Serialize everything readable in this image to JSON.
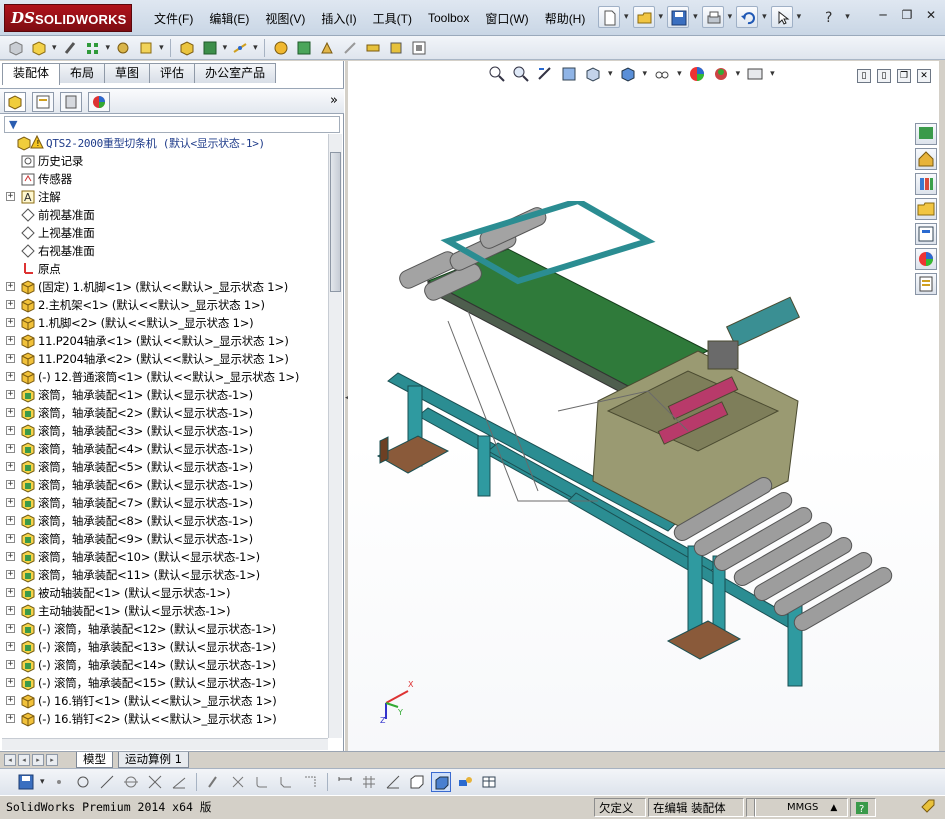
{
  "app": {
    "logo_prefix": "DS",
    "logo_name": "SOLIDWORKS"
  },
  "menu": [
    "文件(F)",
    "编辑(E)",
    "视图(V)",
    "插入(I)",
    "工具(T)",
    "Toolbox",
    "窗口(W)",
    "帮助(H)"
  ],
  "tabs": [
    "装配体",
    "布局",
    "草图",
    "评估",
    "办公室产品"
  ],
  "tree": {
    "root": "QTS2-2000重型切条机  (默认<显示状态-1>)",
    "items": [
      {
        "label": "历史记录",
        "icon": "history-icon",
        "exp": false
      },
      {
        "label": "传感器",
        "icon": "sensor-icon",
        "exp": false
      },
      {
        "label": "注解",
        "icon": "annotation-icon",
        "exp": true
      },
      {
        "label": "前视基准面",
        "icon": "plane-icon",
        "exp": false
      },
      {
        "label": "上视基准面",
        "icon": "plane-icon",
        "exp": false
      },
      {
        "label": "右视基准面",
        "icon": "plane-icon",
        "exp": false
      },
      {
        "label": "原点",
        "icon": "origin-icon",
        "exp": false
      },
      {
        "label": "(固定) 1.机脚<1> (默认<<默认>_显示状态 1>)",
        "icon": "part-icon",
        "exp": true
      },
      {
        "label": "2.主机架<1> (默认<<默认>_显示状态 1>)",
        "icon": "part-icon",
        "exp": true
      },
      {
        "label": "1.机脚<2> (默认<<默认>_显示状态 1>)",
        "icon": "part-icon",
        "exp": true
      },
      {
        "label": "11.P204轴承<1> (默认<<默认>_显示状态 1>)",
        "icon": "part-icon",
        "exp": true
      },
      {
        "label": "11.P204轴承<2> (默认<<默认>_显示状态 1>)",
        "icon": "part-icon",
        "exp": true
      },
      {
        "label": "(-) 12.普通滚筒<1> (默认<<默认>_显示状态 1>)",
        "icon": "part-icon",
        "exp": true
      },
      {
        "label": "滚筒，轴承装配<1> (默认<显示状态-1>)",
        "icon": "assembly-icon",
        "exp": true
      },
      {
        "label": "滚筒，轴承装配<2> (默认<显示状态-1>)",
        "icon": "assembly-icon",
        "exp": true
      },
      {
        "label": "滚筒，轴承装配<3> (默认<显示状态-1>)",
        "icon": "assembly-icon",
        "exp": true
      },
      {
        "label": "滚筒，轴承装配<4> (默认<显示状态-1>)",
        "icon": "assembly-icon",
        "exp": true
      },
      {
        "label": "滚筒，轴承装配<5> (默认<显示状态-1>)",
        "icon": "assembly-icon",
        "exp": true
      },
      {
        "label": "滚筒，轴承装配<6> (默认<显示状态-1>)",
        "icon": "assembly-icon",
        "exp": true
      },
      {
        "label": "滚筒，轴承装配<7> (默认<显示状态-1>)",
        "icon": "assembly-icon",
        "exp": true
      },
      {
        "label": "滚筒，轴承装配<8> (默认<显示状态-1>)",
        "icon": "assembly-icon",
        "exp": true
      },
      {
        "label": "滚筒，轴承装配<9> (默认<显示状态-1>)",
        "icon": "assembly-icon",
        "exp": true
      },
      {
        "label": "滚筒，轴承装配<10> (默认<显示状态-1>)",
        "icon": "assembly-icon",
        "exp": true
      },
      {
        "label": "滚筒，轴承装配<11> (默认<显示状态-1>)",
        "icon": "assembly-icon",
        "exp": true
      },
      {
        "label": "被动轴装配<1> (默认<显示状态-1>)",
        "icon": "assembly-icon",
        "exp": true
      },
      {
        "label": "主动轴装配<1> (默认<显示状态-1>)",
        "icon": "assembly-icon",
        "exp": true
      },
      {
        "label": "(-) 滚筒，轴承装配<12> (默认<显示状态-1>)",
        "icon": "assembly-icon",
        "exp": true
      },
      {
        "label": "(-) 滚筒，轴承装配<13> (默认<显示状态-1>)",
        "icon": "assembly-icon",
        "exp": true
      },
      {
        "label": "(-) 滚筒，轴承装配<14> (默认<显示状态-1>)",
        "icon": "assembly-icon",
        "exp": true
      },
      {
        "label": "(-) 滚筒，轴承装配<15> (默认<显示状态-1>)",
        "icon": "assembly-icon",
        "exp": true
      },
      {
        "label": "(-) 16.销钉<1> (默认<<默认>_显示状态 1>)",
        "icon": "part-icon",
        "exp": true
      },
      {
        "label": "(-) 16.销钉<2> (默认<<默认>_显示状态 1>)",
        "icon": "part-icon",
        "exp": true
      }
    ]
  },
  "bottom_tabs": [
    "模型",
    "运动算例 1"
  ],
  "status": {
    "product": "SolidWorks Premium 2014 x64 版",
    "undefined": "欠定义",
    "editing": "在编辑 装配体",
    "units": "MMGS"
  },
  "colors": {
    "frame": "#2a8a8e",
    "plate": "#8a8a6a",
    "belt": "#2e7a3a",
    "roller": "#9a9a9a",
    "foot": "#8a5a3a"
  }
}
